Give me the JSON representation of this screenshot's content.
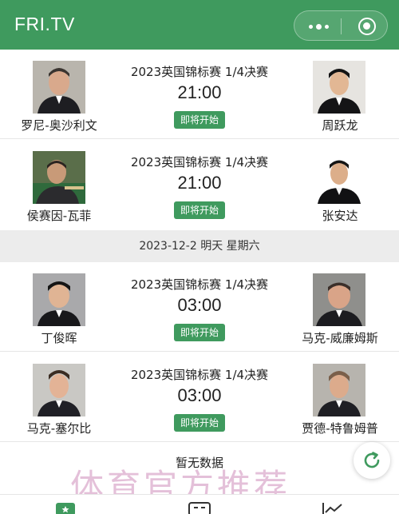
{
  "app": {
    "title": "FRI.TV"
  },
  "matches": [
    {
      "event": "2023英国锦标赛 1/4决赛",
      "time": "21:00",
      "status": "即将开始",
      "left": {
        "name": "罗尼-奥沙利文"
      },
      "right": {
        "name": "周跃龙"
      }
    },
    {
      "event": "2023英国锦标赛 1/4决赛",
      "time": "21:00",
      "status": "即将开始",
      "left": {
        "name": "侯赛因-瓦菲"
      },
      "right": {
        "name": "张安达"
      }
    },
    {
      "event": "2023英国锦标赛 1/4决赛",
      "time": "03:00",
      "status": "即将开始",
      "left": {
        "name": "丁俊晖"
      },
      "right": {
        "name": "马克-威廉姆斯"
      }
    },
    {
      "event": "2023英国锦标赛 1/4决赛",
      "time": "03:00",
      "status": "即将开始",
      "left": {
        "name": "马克-塞尔比"
      },
      "right": {
        "name": "贾德-特鲁姆普"
      }
    }
  ],
  "date_separator": "2023-12-2 明天 星期六",
  "empty_text": "暂无数据",
  "watermark": "体育官方推荐",
  "colors": {
    "brand_green": "#3f9a5e",
    "separator_bg": "#ececec",
    "watermark": "#cd8cb9"
  },
  "icons": [
    "more-icon",
    "target-icon",
    "refresh-icon",
    "trophy-tab-icon",
    "news-tab-icon",
    "chart-tab-icon"
  ]
}
